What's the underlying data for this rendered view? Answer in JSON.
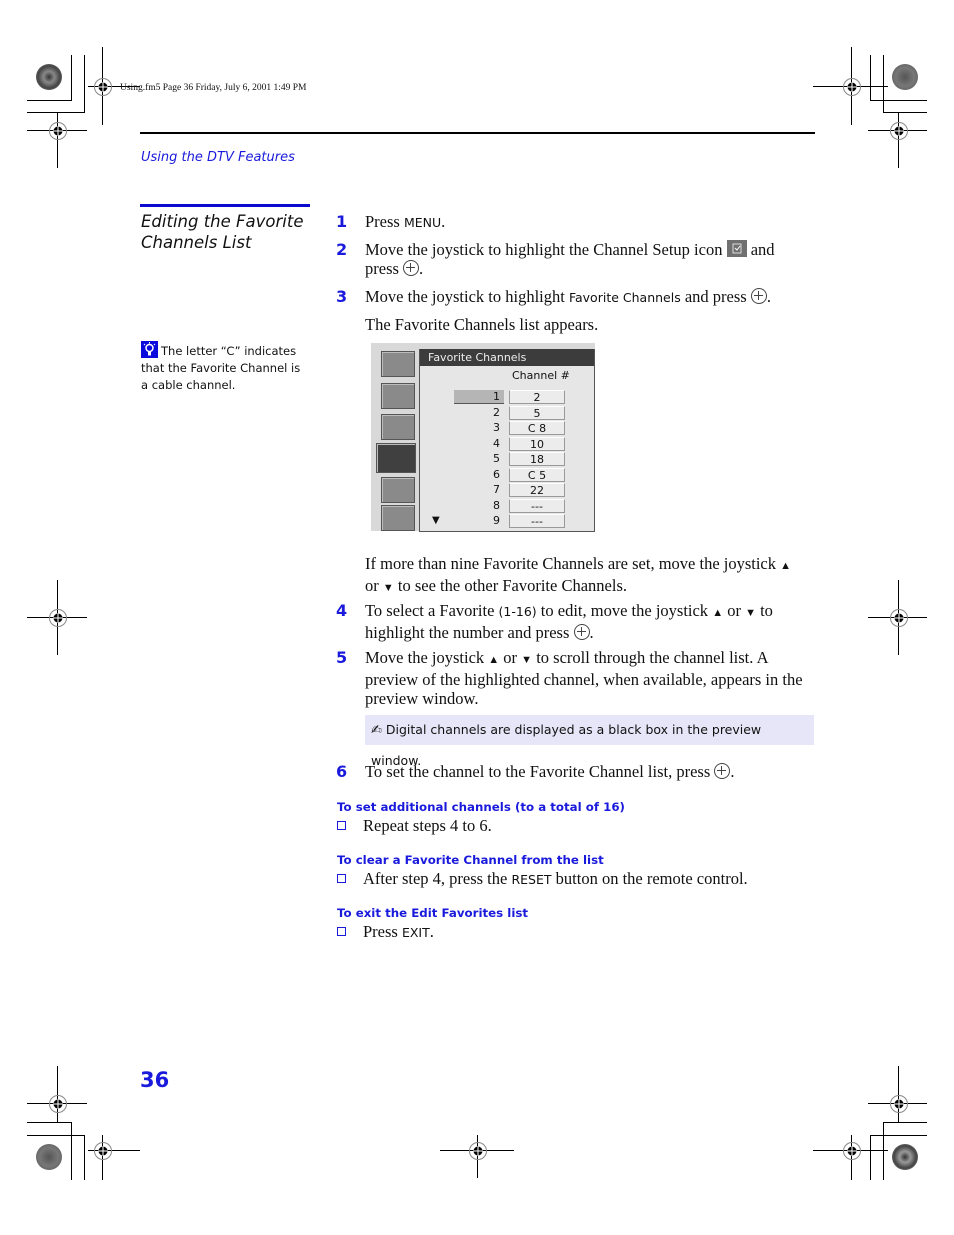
{
  "framemaker_header": "Using.fm5  Page 36  Friday, July 6, 2001  1:49 PM",
  "section_header": "Using the DTV Features",
  "sidebar": {
    "title_line1": "Editing the Favorite",
    "title_line2": "Channels List",
    "tip_icon": "lightbulb-tip-icon",
    "tip_text": "The letter “C” indicates that the Favorite Channel is a cable channel."
  },
  "steps": [
    {
      "num": "1",
      "pre": "Press ",
      "key": "MENU",
      "post": "."
    },
    {
      "num": "2",
      "pre": "Move the joystick to highlight the Channel Setup icon ",
      "mid": " and press ",
      "post": "."
    },
    {
      "num": "3",
      "pre": "Move the joystick to highlight ",
      "key": "Favorite Channels",
      "mid": " and press ",
      "post": ".",
      "after": "The Favorite Channels list appears."
    },
    {
      "num": "4",
      "pre": "To select a Favorite ",
      "key": "(1-16)",
      "mid": " to edit, move the joystick ",
      "or": " or ",
      "mid2": " to highlight the number and press ",
      "post": "."
    },
    {
      "num": "5",
      "pre": "Move the joystick ",
      "or": " or ",
      "post": " to scroll through the channel list. A preview of the highlighted channel, when available, appears in the preview window."
    },
    {
      "num": "6",
      "pre": "To set the channel to the Favorite Channel list, press ",
      "post": "."
    }
  ],
  "more_channels": {
    "pre": "If more than nine Favorite Channels are set, move the joystick ",
    "or": "or ",
    "post": " to see the other Favorite Channels."
  },
  "tv_screen": {
    "title": "Favorite Channels",
    "column_header": "Channel #",
    "highlighted_index": 1,
    "rows": [
      {
        "index": "1",
        "channel": "2"
      },
      {
        "index": "2",
        "channel": "5"
      },
      {
        "index": "3",
        "channel": "C 8"
      },
      {
        "index": "4",
        "channel": "10"
      },
      {
        "index": "5",
        "channel": "18"
      },
      {
        "index": "6",
        "channel": "C 5"
      },
      {
        "index": "7",
        "channel": "22"
      },
      {
        "index": "8",
        "channel": "---"
      },
      {
        "index": "9",
        "channel": "---"
      }
    ],
    "side_icons": [
      "video-icon",
      "audio-icon",
      "settings-puzzle-icon",
      "channel-setup-icon",
      "parental-icon",
      "preview-icon"
    ]
  },
  "note": {
    "icon": "pencil-note-icon",
    "text": "Digital channels are displayed as a black box in the preview window."
  },
  "subsections": [
    {
      "title": "To set additional channels (to a total of 16)",
      "pre": "Repeat steps 4 to 6.",
      "key": "",
      "post": ""
    },
    {
      "title": "To clear a Favorite Channel from the list",
      "pre": "After step 4, press the ",
      "key": "RESET",
      "post": " button on the remote control."
    },
    {
      "title": "To exit the Edit Favorites list",
      "pre": "Press ",
      "key": "EXIT",
      "post": "."
    }
  ],
  "page_number": "36",
  "colors": {
    "accent_blue": "#1a1adc",
    "note_bg": "#e6e6f8"
  }
}
